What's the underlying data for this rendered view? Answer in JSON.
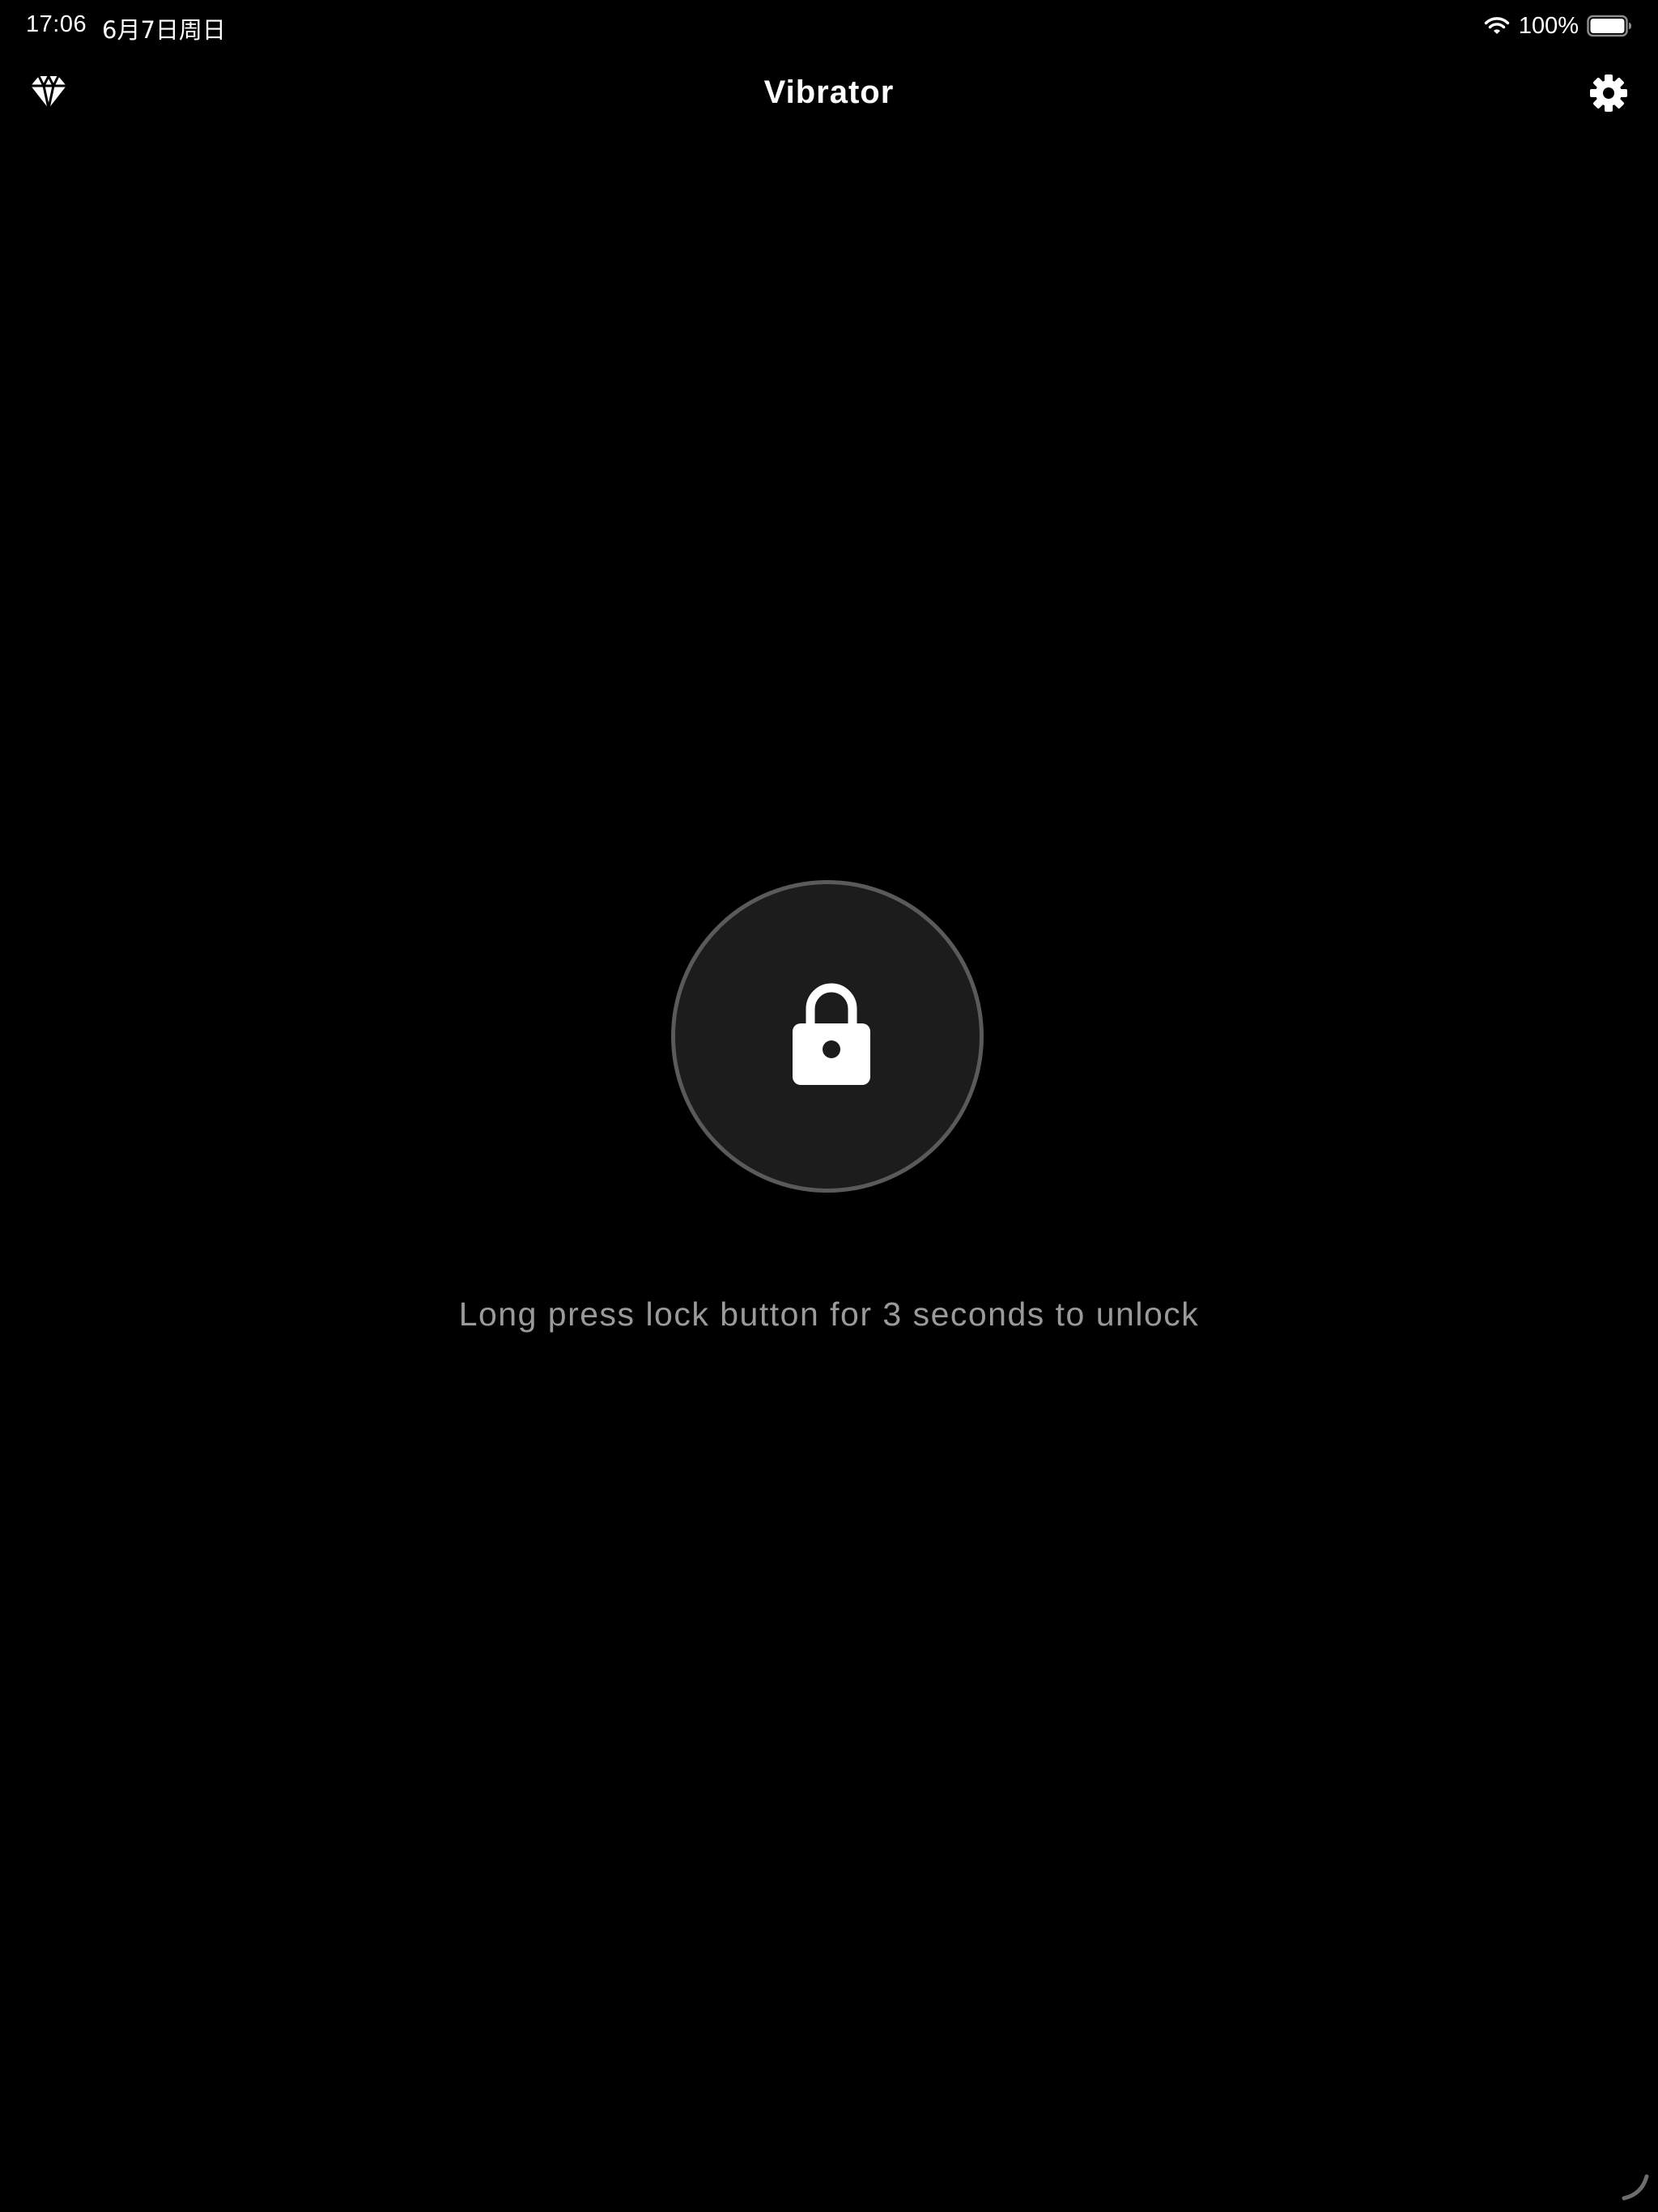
{
  "status_bar": {
    "time": "17:06",
    "date": "6月7日周日",
    "battery_percent": "100%",
    "battery_level": 1.0
  },
  "nav": {
    "title": "Vibrator",
    "left_icon": "diamond-icon",
    "right_icon": "gear-icon"
  },
  "lock": {
    "icon": "lock-icon",
    "hint": "Long press lock button for 3 seconds to unlock"
  },
  "colors": {
    "background": "#000000",
    "button_fill": "#1c1c1c",
    "button_ring": "#5a5a5a",
    "hint_text": "#9a9a9a",
    "foreground": "#ffffff"
  }
}
